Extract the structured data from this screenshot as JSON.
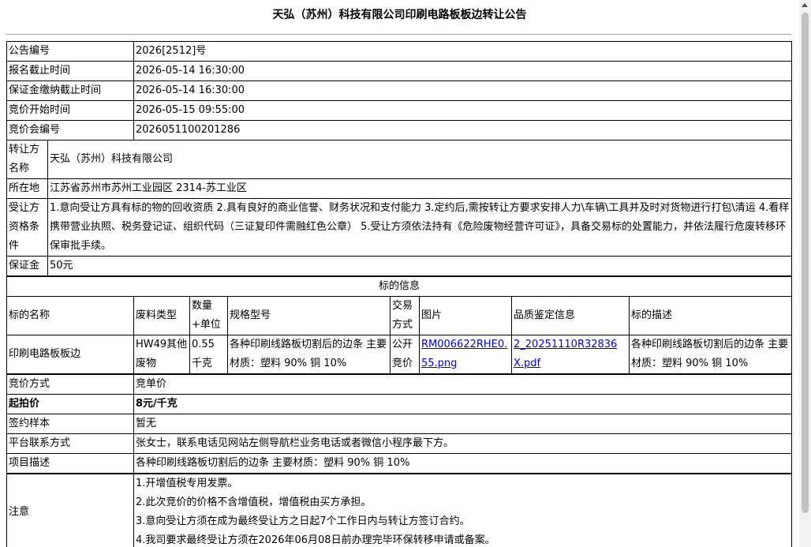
{
  "page_title": "天弘（苏州）科技有限公司印刷电路板板边转让公告",
  "notice": {
    "rows": [
      {
        "label": "公告编号",
        "value": "2026[2512]号"
      },
      {
        "label": "报名截止时间",
        "value": "2026-05-14 16:30:00"
      },
      {
        "label": "保证金缴纳截止时间",
        "value": "2026-05-14 16:30:00"
      },
      {
        "label": "竞价开始时间",
        "value": "2026-05-15 09:55:00"
      },
      {
        "label": "竞价会编号",
        "value": "2026051100201286"
      }
    ]
  },
  "transferor": {
    "name_label": "转让方名称",
    "name_value": "天弘（苏州）科技有限公司",
    "location_label": "所在地",
    "location_value": "江苏省苏州市苏州工业园区 2314-苏工业区",
    "qual_label": "受让方资格条件",
    "qual_value": "1.意向受让方具有标的物的回收资质 2.具有良好的商业信誉、财务状况和支付能力 3.定约后,需按转让方要求安排人力\\车辆\\工具并及时对货物进行打包\\清运 4.看样携带营业执照、税务登记证、组织代码（三证复印件需融红色公章） 5.受让方须依法持有《危险废物经营许可证》，具备交易标的处置能力，并依法履行危废转移环保审批手续。",
    "deposit_label": "保证金",
    "deposit_value": "50元"
  },
  "lot": {
    "section_title": "标的信息",
    "headers": [
      "标的名称",
      "废料类型",
      "数量+单位",
      "规格型号",
      "交易方式",
      "图片",
      "品质鉴定信息",
      "标的描述"
    ],
    "row": {
      "name": "印刷电路板板边",
      "waste_type": "HW49其他废物",
      "quantity": "0.55 千克",
      "spec": "各种印刷线路板切割后的边条 主要材质：塑料 90% 铜 10%",
      "trade_mode": "公开竞价",
      "image_link": "RM006622RHE0.55.png",
      "quality_link": "2_20251110R32836X.pdf",
      "description": "各种印刷线路板切割后的边条 主要材质：塑料 90% 铜 10%"
    }
  },
  "bidding": {
    "rows": [
      {
        "label": "竞价方式",
        "value": "竞单价",
        "bold": false
      },
      {
        "label": "起拍价",
        "value": "8元/千克",
        "bold": true
      },
      {
        "label": "签约样本",
        "value": "暂无",
        "bold": false
      },
      {
        "label": "平台联系方式",
        "value": "张女士，联系电话见网站左侧导航栏业务电话或者微信小程序最下方。",
        "bold": false
      },
      {
        "label": "项目描述",
        "value": "各种印刷线路板切割后的边条 主要材质：塑料 90% 铜 10%",
        "bold": false
      }
    ]
  },
  "notes": {
    "label": "注意",
    "items": [
      "1.开增值税专用发票。",
      "2.此次竞价的价格不含增值税，增值税由买方承担。",
      "3.意向受让方须在成为最终受让方之日起7个工作日内与转让方签订合约。",
      "4.我司要求最终受让方须在2026年06月08日前办理完毕环保转移申请或备案。"
    ]
  }
}
